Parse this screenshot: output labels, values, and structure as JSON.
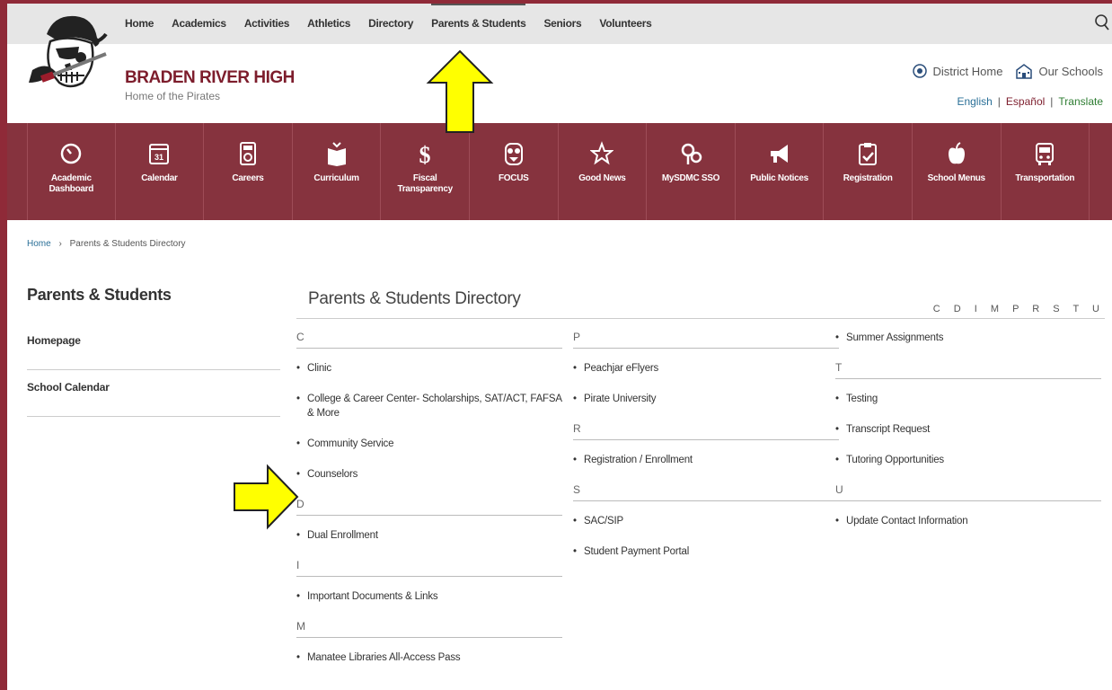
{
  "topnav": {
    "items": [
      "Home",
      "Academics",
      "Activities",
      "Athletics",
      "Directory",
      "Parents & Students",
      "Seniors",
      "Volunteers"
    ],
    "active": "Parents & Students"
  },
  "school": {
    "name": "BRADEN RIVER HIGH",
    "tagline": "Home of the Pirates"
  },
  "util": {
    "district_home": "District Home",
    "our_schools": "Our Schools"
  },
  "languages": {
    "english": "English",
    "espanol": "Español",
    "translate": "Translate",
    "separator": "|"
  },
  "iconbar": [
    {
      "label": "Academic\nDashboard",
      "icon": "speedometer-icon"
    },
    {
      "label": "Calendar",
      "icon": "calendar-icon"
    },
    {
      "label": "Careers",
      "icon": "jobs-icon"
    },
    {
      "label": "Curriculum",
      "icon": "book-icon"
    },
    {
      "label": "Fiscal\nTransparency",
      "icon": "dollar-icon"
    },
    {
      "label": "FOCUS",
      "icon": "owl-icon"
    },
    {
      "label": "Good News",
      "icon": "star-icon"
    },
    {
      "label": "MySDMC SSO",
      "icon": "sso-icon"
    },
    {
      "label": "Public Notices",
      "icon": "megaphone-icon"
    },
    {
      "label": "Registration",
      "icon": "clipboard-icon"
    },
    {
      "label": "School Menus",
      "icon": "apple-icon"
    },
    {
      "label": "Transportation",
      "icon": "bus-icon"
    }
  ],
  "breadcrumb": {
    "home": "Home",
    "separator": "›",
    "current": "Parents & Students Directory"
  },
  "sidebar": {
    "title": "Parents & Students",
    "items": [
      "Homepage",
      "School Calendar"
    ]
  },
  "directory": {
    "title": "Parents & Students Directory",
    "alphabet": "C D I M P R S T U",
    "columns": [
      [
        {
          "letter": "C",
          "entries": [
            "Clinic",
            "College & Career Center- Scholarships, SAT/ACT, FAFSA & More",
            "Community Service",
            "Counselors"
          ]
        },
        {
          "letter": "D",
          "entries": [
            "Dual Enrollment"
          ]
        },
        {
          "letter": "I",
          "entries": [
            "Important Documents & Links"
          ]
        },
        {
          "letter": "M",
          "entries": [
            "Manatee Libraries All-Access Pass"
          ]
        }
      ],
      [
        {
          "letter": "P",
          "entries": [
            "Peachjar eFlyers",
            "Pirate University"
          ]
        },
        {
          "letter": "R",
          "entries": [
            "Registration / Enrollment"
          ]
        },
        {
          "letter": "S",
          "entries": [
            "SAC/SIP",
            "Student Payment Portal"
          ]
        }
      ],
      [
        {
          "letter": "",
          "entries": [
            "Summer Assignments"
          ]
        },
        {
          "letter": "T",
          "entries": [
            "Testing",
            "Transcript Request",
            "Tutoring Opportunities"
          ]
        },
        {
          "letter": "U",
          "entries": [
            "Update Contact Information"
          ]
        }
      ]
    ]
  },
  "colors": {
    "maroon": "#86333e",
    "highlight_arrow": "#ffff00"
  }
}
